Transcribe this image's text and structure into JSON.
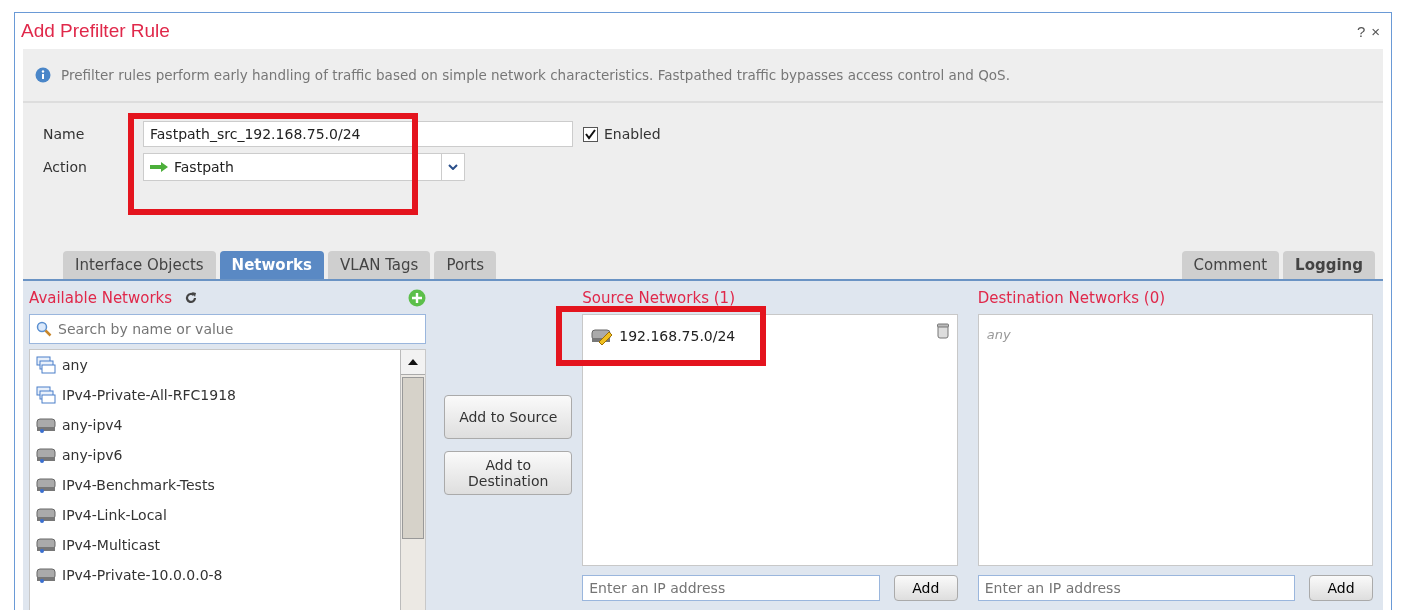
{
  "dialog": {
    "title": "Add Prefilter Rule",
    "help": "?",
    "close": "×"
  },
  "info": "Prefilter rules perform early handling of traffic based on simple network characteristics. Fastpathed traffic bypasses access control and QoS.",
  "form": {
    "name_label": "Name",
    "name_value": "Fastpath_src_192.168.75.0/24",
    "enabled_label": "Enabled",
    "enabled": true,
    "action_label": "Action",
    "action_value": "Fastpath"
  },
  "tabs_left": [
    {
      "label": "Interface Objects",
      "selected": false
    },
    {
      "label": "Networks",
      "selected": true
    },
    {
      "label": "VLAN Tags",
      "selected": false
    },
    {
      "label": "Ports",
      "selected": false
    }
  ],
  "tabs_right": [
    {
      "label": "Comment",
      "selected": false,
      "bold": false
    },
    {
      "label": "Logging",
      "selected": false,
      "bold": true
    }
  ],
  "available": {
    "title": "Available Networks",
    "search_placeholder": "Search by name or value",
    "items": [
      {
        "label": "any",
        "kind": "group"
      },
      {
        "label": "IPv4-Private-All-RFC1918",
        "kind": "group"
      },
      {
        "label": "any-ipv4",
        "kind": "host"
      },
      {
        "label": "any-ipv6",
        "kind": "host"
      },
      {
        "label": "IPv4-Benchmark-Tests",
        "kind": "host"
      },
      {
        "label": "IPv4-Link-Local",
        "kind": "host"
      },
      {
        "label": "IPv4-Multicast",
        "kind": "host"
      },
      {
        "label": "IPv4-Private-10.0.0.0-8",
        "kind": "host"
      }
    ]
  },
  "buttons": [
    "Add to Source",
    "Add to Destination"
  ],
  "source": {
    "title": "Source Networks (1)",
    "items": [
      "192.168.75.0/24"
    ],
    "ip_placeholder": "Enter an IP address",
    "add": "Add"
  },
  "destination": {
    "title": "Destination Networks (0)",
    "empty": "any",
    "ip_placeholder": "Enter an IP address",
    "add": "Add"
  }
}
